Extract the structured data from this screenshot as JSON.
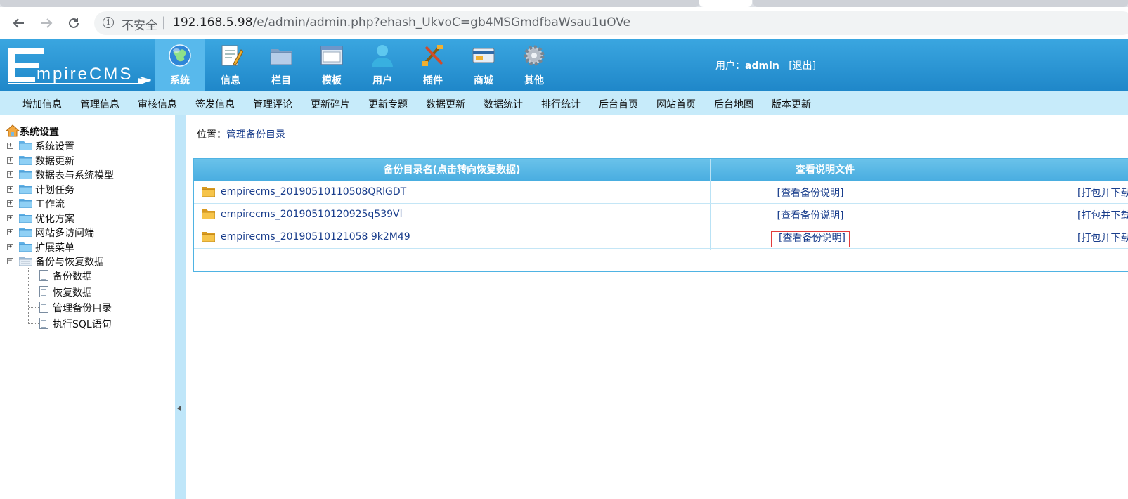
{
  "browser": {
    "security_label": "不安全",
    "url_host": "192.168.5.98",
    "url_path": "/e/admin/admin.php?ehash_UkvoC=gb4MSGmdfbaWsau1uOVe",
    "back_icon": "arrow-left-icon",
    "forward_icon": "arrow-right-icon",
    "reload_icon": "reload-icon"
  },
  "header": {
    "logo_text": "EmpireCMS",
    "menu": [
      {
        "label": "系统",
        "icon": "globe-icon"
      },
      {
        "label": "信息",
        "icon": "notepad-icon"
      },
      {
        "label": "栏目",
        "icon": "folder-icon"
      },
      {
        "label": "模板",
        "icon": "window-icon"
      },
      {
        "label": "用户",
        "icon": "user-icon"
      },
      {
        "label": "插件",
        "icon": "tools-icon"
      },
      {
        "label": "商城",
        "icon": "card-icon"
      },
      {
        "label": "其他",
        "icon": "gear-icon"
      }
    ],
    "user_prefix": "用户：",
    "username": "admin",
    "logout": "[退出]"
  },
  "subnav": [
    "增加信息",
    "管理信息",
    "审核信息",
    "签发信息",
    "管理评论",
    "更新碎片",
    "更新专题",
    "数据更新",
    "数据统计",
    "排行统计",
    "后台首页",
    "网站首页",
    "后台地图",
    "版本更新"
  ],
  "sidebar": {
    "root": "系统设置",
    "nodes": [
      "系统设置",
      "数据更新",
      "数据表与系统模型",
      "计划任务",
      "工作流",
      "优化方案",
      "网站多访问端",
      "扩展菜单",
      "备份与恢复数据"
    ],
    "leaves": [
      "备份数据",
      "恢复数据",
      "管理备份目录",
      "执行SQL语句"
    ]
  },
  "main": {
    "position_label": "位置：",
    "position_link": "管理备份目录",
    "table": {
      "headers": [
        "备份目录名(点击转向恢复数据)",
        "查看说明文件",
        ""
      ],
      "rows": [
        {
          "name": "empirecms_20190510110508QRlGDT",
          "view": "[查看备份说明]",
          "pack": "[打包并下载]"
        },
        {
          "name": "empirecms_20190510120925q539Vl",
          "view": "[查看备份说明]",
          "pack": "[打包并下载]"
        },
        {
          "name": "empirecms_20190510121058 9k2M49",
          "view": "[查看备份说明]",
          "pack": "[打包并下载]"
        }
      ]
    }
  },
  "colors": {
    "header_blue": "#2c93d3",
    "subnav_bg": "#c7ebfa",
    "table_head": "#5cb9e6",
    "link": "#1a3e8c",
    "highlight_box": "#e23b3b"
  }
}
